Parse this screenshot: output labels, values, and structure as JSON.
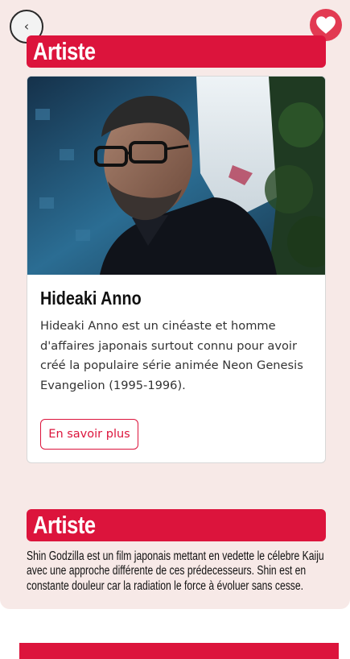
{
  "header": {
    "back_icon_glyph": "‹",
    "back_icon": "chevron-left-icon",
    "favorite_icon": "heart-icon",
    "favorite_color": "#e23a52"
  },
  "sections": [
    {
      "title": "Artiste",
      "card": {
        "image": "portrait-photo",
        "name": "Hideaki Anno",
        "description": "Hideaki Anno est un cinéaste et homme d'affaires japonais surtout connu pour avoir créé la populaire série animée Neon Genesis Evangelion (1995-1996).",
        "button_label": "En savoir plus"
      }
    },
    {
      "title": "Artiste",
      "description": "Shin Godzilla est un film japonais mettant en vedette le célebre Kaiju avec une approche différente de ces prédecesseurs. Shin est en constante douleur car la radiation le force à évoluer sans cesse."
    }
  ],
  "colors": {
    "accent": "#dc143c",
    "panel_background": "#f7e9e7"
  }
}
